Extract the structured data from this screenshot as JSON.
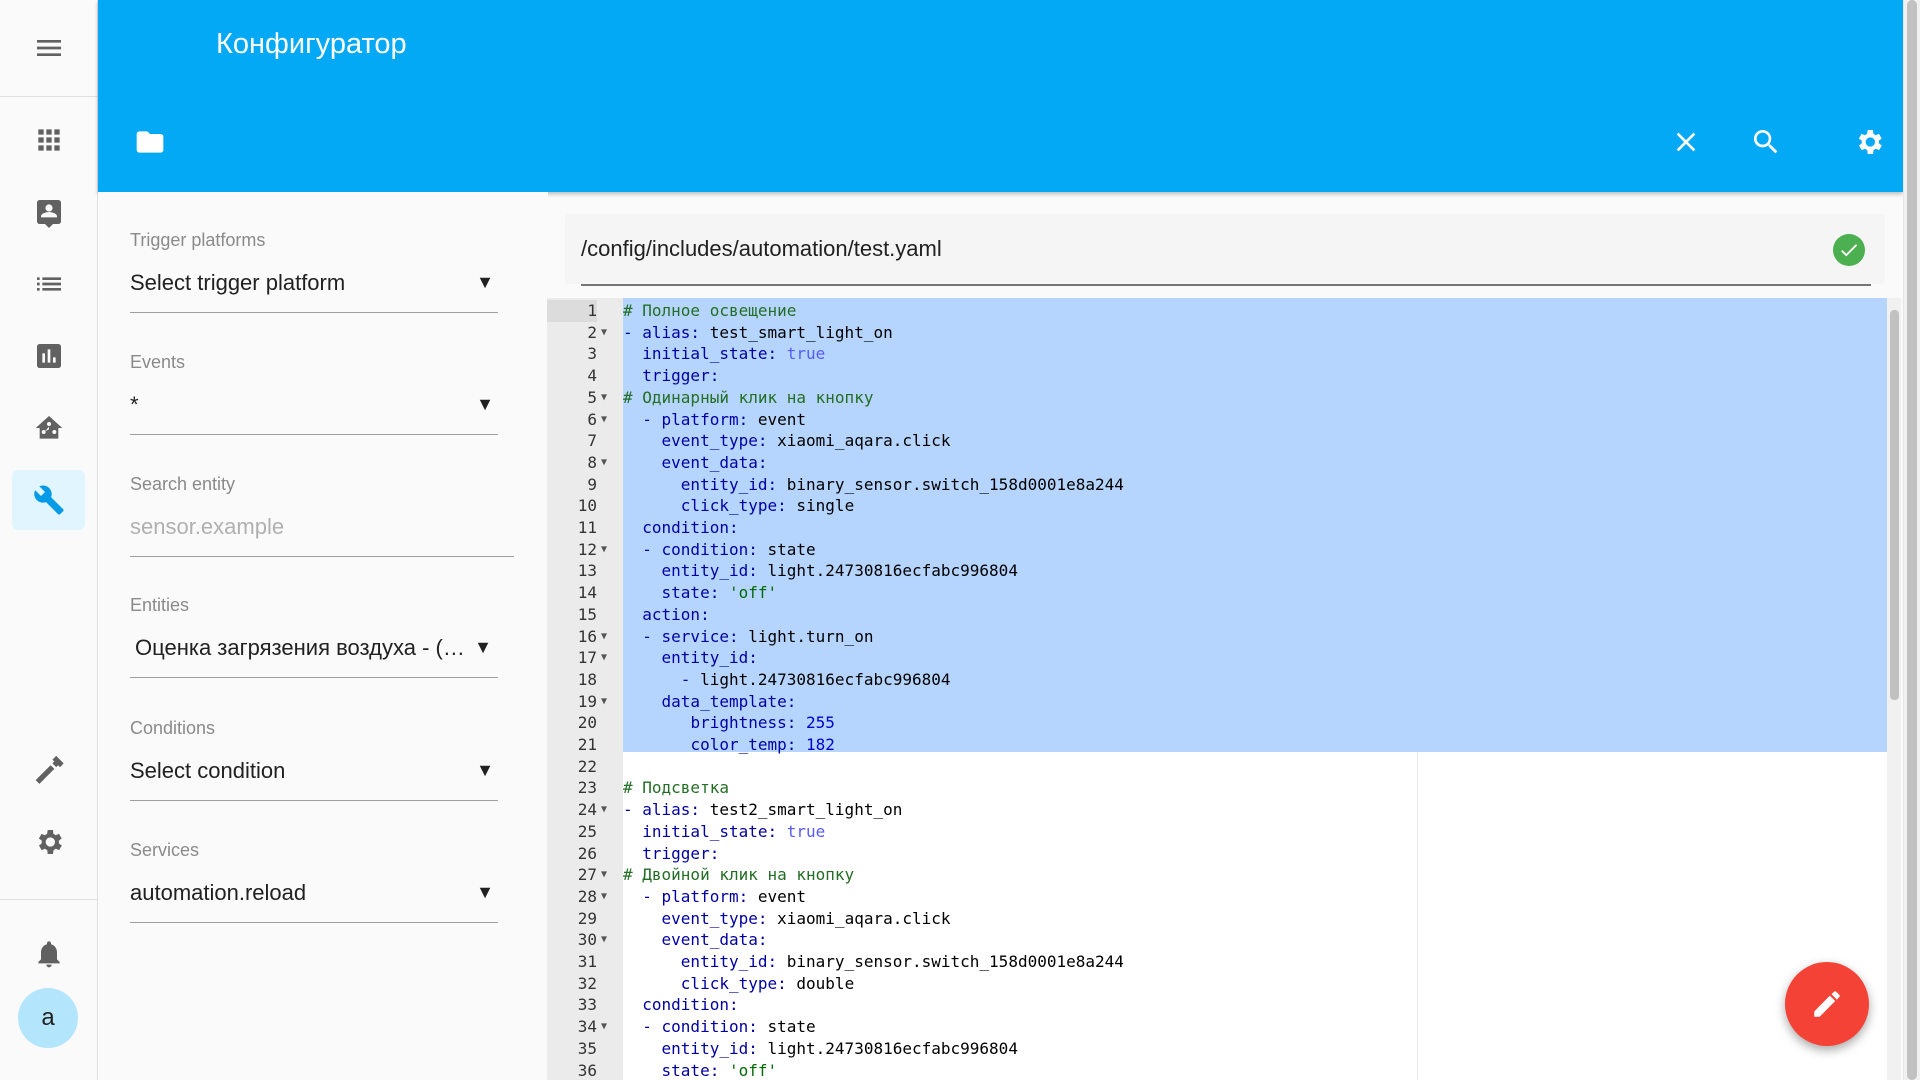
{
  "app": {
    "title": "Конфигуратор",
    "accent_color": "#03a9f4",
    "fab_color": "#f44336"
  },
  "sidebar": {
    "items": [
      {
        "name": "apps-icon"
      },
      {
        "name": "account-box-icon"
      },
      {
        "name": "list-icon"
      },
      {
        "name": "chart-icon"
      },
      {
        "name": "home-network-icon"
      },
      {
        "name": "wrench-icon",
        "active": true
      },
      {
        "name": "hammer-icon"
      },
      {
        "name": "gear-icon"
      },
      {
        "name": "bell-icon"
      }
    ],
    "avatar_letter": "a"
  },
  "form": {
    "trigger_platforms": {
      "label": "Trigger platforms",
      "value": "Select trigger platform"
    },
    "events": {
      "label": "Events",
      "value": "*"
    },
    "search_entity": {
      "label": "Search entity",
      "placeholder": "sensor.example"
    },
    "entities": {
      "label": "Entities",
      "value": "Оценка загрязения воздуха - (sensor.air_quality)"
    },
    "conditions": {
      "label": "Conditions",
      "value": "Select condition"
    },
    "services": {
      "label": "Services",
      "value": "automation.reload"
    }
  },
  "editor": {
    "file_path": "/config/includes/automation/test.yaml",
    "status": "saved-check",
    "lines": [
      "# Полное освещение",
      "- alias: test_smart_light_on",
      "  initial_state: true",
      "  trigger:",
      "# Одинарный клик на кнопку",
      "  - platform: event",
      "    event_type: xiaomi_aqara.click",
      "    event_data:",
      "      entity_id: binary_sensor.switch_158d0001e8a244",
      "      click_type: single",
      "  condition:",
      "  - condition: state",
      "    entity_id: light.24730816ecfabc996804",
      "    state: 'off'",
      "  action:",
      "  - service: light.turn_on",
      "    entity_id:",
      "      - light.24730816ecfabc996804",
      "    data_template:",
      "       brightness: 255",
      "       color_temp: 182",
      "",
      "# Подсветка",
      "- alias: test2_smart_light_on",
      "  initial_state: true",
      "  trigger:",
      "# Двойной клик на кнопку",
      "  - platform: event",
      "    event_type: xiaomi_aqara.click",
      "    event_data:",
      "      entity_id: binary_sensor.switch_158d0001e8a244",
      "      click_type: double",
      "  condition:",
      "  - condition: state",
      "    entity_id: light.24730816ecfabc996804",
      "    state: 'off'"
    ],
    "fold_lines": [
      2,
      5,
      6,
      8,
      12,
      16,
      17,
      19,
      24,
      27,
      28,
      30,
      34
    ]
  }
}
